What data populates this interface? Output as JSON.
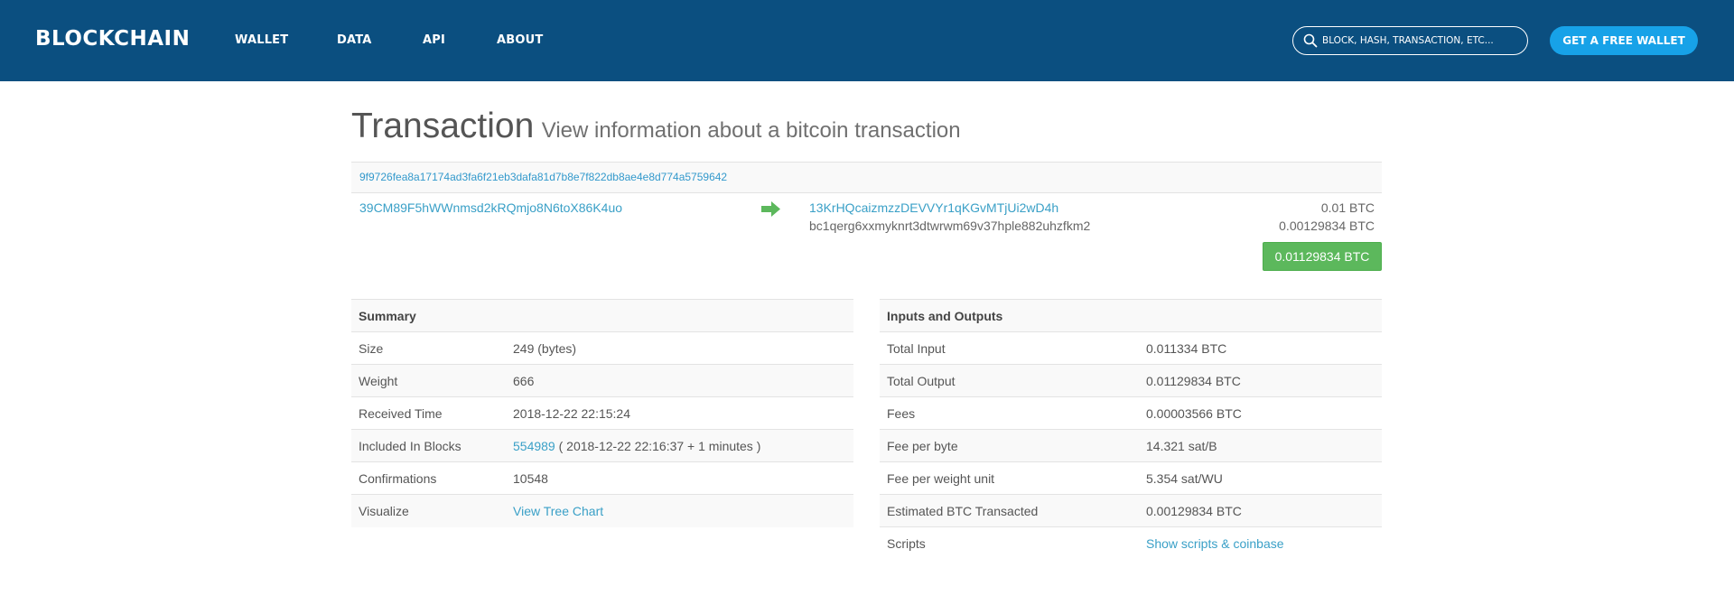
{
  "header": {
    "logo": "BLOCKCHAIN",
    "nav": [
      "WALLET",
      "DATA",
      "API",
      "ABOUT"
    ],
    "search_placeholder": "BLOCK, HASH, TRANSACTION, ETC...",
    "cta_label": "GET A FREE WALLET",
    "colors": {
      "bar": "#0b4f80",
      "cta": "#17a2e8"
    }
  },
  "page": {
    "title": "Transaction",
    "subtitle": "View information about a bitcoin transaction"
  },
  "transaction": {
    "hash": "9f9726fea8a17174ad3fa6f21eb3dafa81d7b8e7f822db8ae4e8d774a5759642",
    "inputs": [
      "39CM89F5hWWnmsd2kRQmjo8N6toX86K4uo"
    ],
    "outputs": [
      {
        "address": "13KrHQcaizmzzDEVVYr1qKGvMTjUi2wD4h",
        "amount": "0.01 BTC",
        "linked": true
      },
      {
        "address": "bc1qerg6xxmyknrt3dtwrwm69v37hple882uhzfkm2",
        "amount": "0.00129834 BTC",
        "linked": false
      }
    ],
    "total_badge": "0.01129834 BTC",
    "badge_color": "#5cb85c"
  },
  "summary": {
    "heading": "Summary",
    "size": {
      "label": "Size",
      "value": "249 (bytes)"
    },
    "weight": {
      "label": "Weight",
      "value": "666"
    },
    "received": {
      "label": "Received Time",
      "value": "2018-12-22 22:15:24"
    },
    "blocks": {
      "label": "Included In Blocks",
      "block": "554989",
      "detail": "( 2018-12-22 22:16:37 + 1 minutes )"
    },
    "confirmations": {
      "label": "Confirmations",
      "value": "10548"
    },
    "visualize": {
      "label": "Visualize",
      "link": "View Tree Chart"
    }
  },
  "io": {
    "heading": "Inputs and Outputs",
    "total_input": {
      "label": "Total Input",
      "value": "0.011334 BTC"
    },
    "total_output": {
      "label": "Total Output",
      "value": "0.01129834 BTC"
    },
    "fees": {
      "label": "Fees",
      "value": "0.00003566 BTC"
    },
    "fee_byte": {
      "label": "Fee per byte",
      "value": "14.321 sat/B"
    },
    "fee_wu": {
      "label": "Fee per weight unit",
      "value": "5.354 sat/WU"
    },
    "estimated": {
      "label": "Estimated BTC Transacted",
      "value": "0.00129834 BTC"
    },
    "scripts": {
      "label": "Scripts",
      "link": "Show scripts & coinbase"
    }
  }
}
